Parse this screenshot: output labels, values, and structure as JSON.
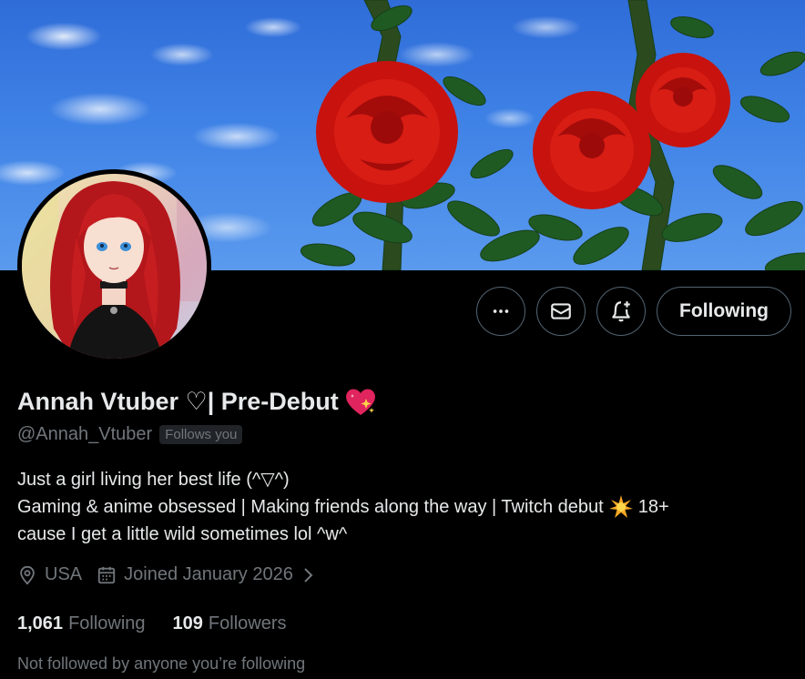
{
  "profile": {
    "display_name": "Annah Vtuber ♡| Pre-Debut",
    "handle": "@Annah_Vtuber",
    "follows_you_badge": "Follows you",
    "bio_line1": "Just a girl living her best life (^▽^)",
    "bio_line2_before": "Gaming & anime obsessed | Making friends along the way | Twitch debut",
    "bio_line2_after": "18+",
    "bio_line3": "cause I get a little wild sometimes lol ^w^",
    "location": "USA",
    "joined": "Joined January 2026",
    "following_count": "1,061",
    "following_label": "Following",
    "followers_count": "109",
    "followers_label": "Followers",
    "not_followed_text": "Not followed by anyone you’re following"
  },
  "actions": {
    "more_icon": "more-horizontal-icon",
    "message_icon": "envelope-icon",
    "notify_icon": "bell-plus-icon",
    "follow_label": "Following"
  },
  "icons": {
    "location": "location-pin-icon",
    "calendar": "calendar-icon",
    "chevron": "chevron-right-icon",
    "name_emoji": "sparkling-heart-emoji",
    "bio_emoji": "glowing-star-emoji"
  },
  "colors": {
    "background": "#000000",
    "primary_text": "#e7e9ea",
    "secondary_text": "#71767b",
    "border": "#536471",
    "badge_bg": "#202327"
  }
}
